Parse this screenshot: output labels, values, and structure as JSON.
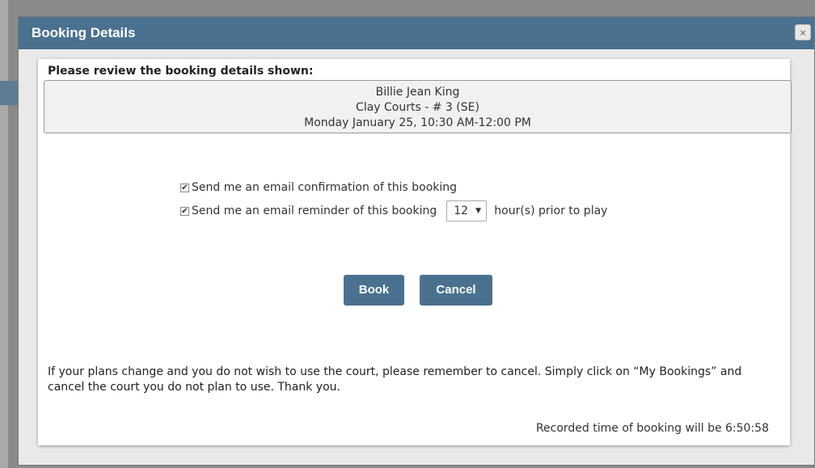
{
  "dialog": {
    "title": "Booking Details",
    "close_label": "×"
  },
  "review": {
    "heading": "Please review the booking details shown:",
    "player": "Billie Jean King",
    "court": "Clay Courts - # 3 (SE)",
    "datetime": "Monday January 25, 10:30 AM-12:00 PM"
  },
  "options": {
    "confirmation": {
      "checked": true,
      "label": "Send me an email confirmation of this booking"
    },
    "reminder": {
      "checked": true,
      "label": "Send me an email reminder of this booking",
      "hours_value": "12",
      "suffix": "hour(s) prior to play"
    }
  },
  "buttons": {
    "book": "Book",
    "cancel": "Cancel"
  },
  "notice": "If your plans change and you do not wish to use the court, please remember to cancel. Simply click on “My Bookings” and cancel the court you do not plan to use. Thank you.",
  "recorded_time": "Recorded time of booking will be 6:50:58",
  "colors": {
    "titlebar": "#4a7190",
    "button": "#4a7190",
    "dialog_bg": "#e9e9e9"
  },
  "icons": {
    "close": "close-icon",
    "checkbox_check": "checkmark-icon",
    "select_arrow": "chevron-down-icon"
  }
}
